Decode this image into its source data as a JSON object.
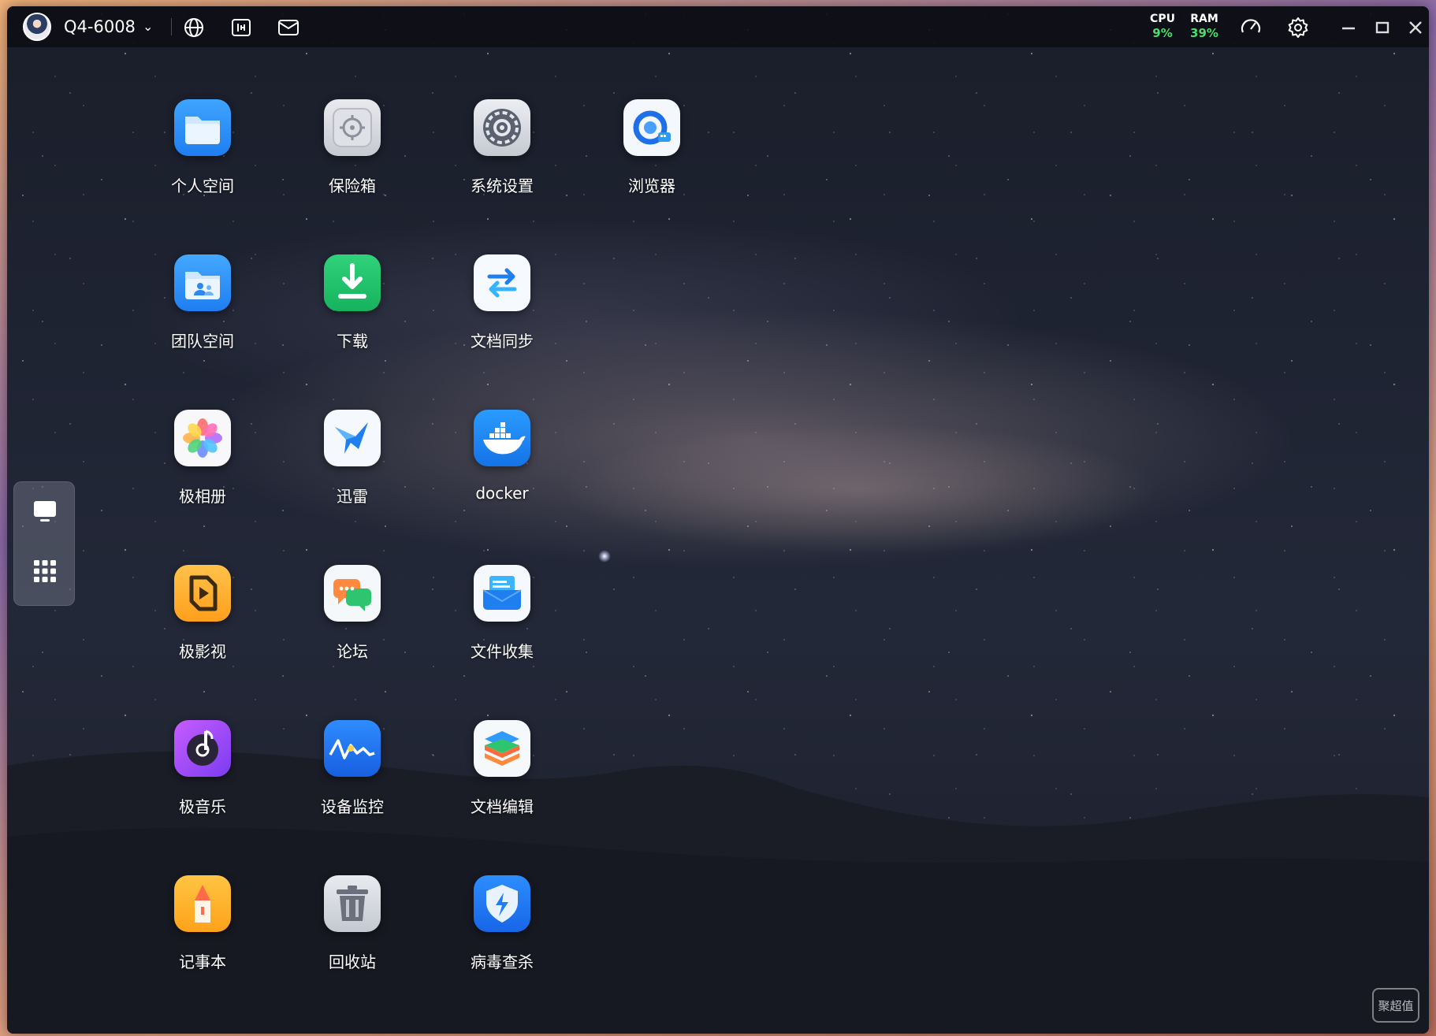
{
  "titlebar": {
    "device_name": "Q4-6008",
    "caret": "⌄",
    "cpu_label": "CPU",
    "cpu_value": "9%",
    "ram_label": "RAM",
    "ram_value": "39%",
    "left_icons": [
      "globe-icon",
      "share-box-icon",
      "mail-icon"
    ],
    "right_icons": [
      "gauge-icon",
      "gear-icon",
      "minimize-icon",
      "maximize-icon",
      "close-icon"
    ]
  },
  "sidebar": {
    "items": [
      {
        "icon": "desktop-icon"
      },
      {
        "icon": "app-grid-icon"
      }
    ]
  },
  "apps": [
    {
      "label": "个人空间",
      "icon": "folder-icon"
    },
    {
      "label": "保险箱",
      "icon": "safe-icon"
    },
    {
      "label": "系统设置",
      "icon": "settings-gear-icon"
    },
    {
      "label": "浏览器",
      "icon": "browser-icon"
    },
    {
      "label": "团队空间",
      "icon": "team-folder-icon"
    },
    {
      "label": "下载",
      "icon": "download-icon"
    },
    {
      "label": "文档同步",
      "icon": "sync-arrows-icon"
    },
    {
      "label": "极相册",
      "icon": "photo-flower-icon"
    },
    {
      "label": "迅雷",
      "icon": "thunder-bird-icon"
    },
    {
      "label": "docker",
      "icon": "docker-whale-icon"
    },
    {
      "label": "极影视",
      "icon": "video-icon"
    },
    {
      "label": "论坛",
      "icon": "forum-chat-icon"
    },
    {
      "label": "文件收集",
      "icon": "file-collect-icon"
    },
    {
      "label": "极音乐",
      "icon": "music-disc-icon"
    },
    {
      "label": "设备监控",
      "icon": "monitor-wave-icon"
    },
    {
      "label": "文档编辑",
      "icon": "layers-icon"
    },
    {
      "label": "记事本",
      "icon": "notepad-pencil-icon"
    },
    {
      "label": "回收站",
      "icon": "trash-icon"
    },
    {
      "label": "病毒查杀",
      "icon": "shield-bolt-icon"
    }
  ],
  "watermark": "聚超值",
  "colors": {
    "accent_green": "#4ade6b",
    "titlebar_bg": "#0c0e14"
  }
}
